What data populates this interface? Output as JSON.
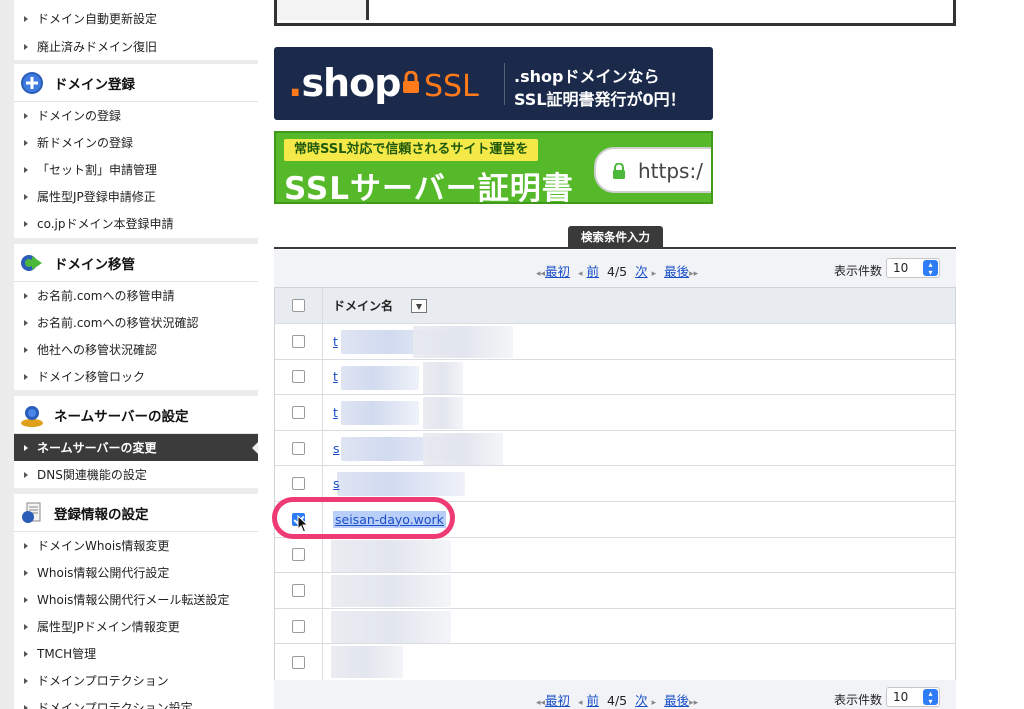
{
  "sidebar": {
    "top_items": [
      {
        "label": "ドメイン自動更新設定"
      },
      {
        "label": "廃止済みドメイン復旧"
      }
    ],
    "sections": [
      {
        "title": "ドメイン登録",
        "icon": "plus-circle-icon",
        "items": [
          {
            "label": "ドメインの登録"
          },
          {
            "label": "新ドメインの登録"
          },
          {
            "label": "「セット割」申請管理"
          },
          {
            "label": "属性型JP登録申請修正"
          },
          {
            "label": "co.jpドメイン本登録申請"
          }
        ]
      },
      {
        "title": "ドメイン移管",
        "icon": "transfer-icon",
        "items": [
          {
            "label": "お名前.comへの移管申請"
          },
          {
            "label": "お名前.comへの移管状況確認"
          },
          {
            "label": "他社への移管状況確認"
          },
          {
            "label": "ドメイン移管ロック"
          }
        ]
      },
      {
        "title": "ネームサーバーの設定",
        "icon": "users-icon",
        "items": [
          {
            "label": "ネームサーバーの変更",
            "active": true
          },
          {
            "label": "DNS関連機能の設定"
          }
        ]
      },
      {
        "title": "登録情報の設定",
        "icon": "document-icon",
        "items": [
          {
            "label": "ドメインWhois情報変更"
          },
          {
            "label": "Whois情報公開代行設定"
          },
          {
            "label": "Whois情報公開代行メール転送設定"
          },
          {
            "label": "属性型JPドメイン情報変更"
          },
          {
            "label": "TMCH管理"
          },
          {
            "label": "ドメインプロテクション"
          },
          {
            "label": "ドメインプロテクション設定"
          }
        ]
      }
    ]
  },
  "banners": {
    "shop": {
      "logo_dot": ".",
      "logo_text": "shop",
      "ssl_text": "SSL",
      "line1": ".shopドメインなら",
      "line2": "SSL証明書発行が0円！"
    },
    "ssl": {
      "pill": "常時SSL対応で信頼されるサイト運営を",
      "big": "SSLサーバー証明書",
      "url": "https:/"
    }
  },
  "search_tab": "検索条件入力",
  "pager": {
    "first": "最初",
    "prev": "前",
    "page": "4/5",
    "next": "次",
    "last": "最後",
    "count_label": "表示件数",
    "count_value": "10",
    "left_arrows": "◂◂",
    "right_arrows": "▸▸",
    "left_arrow": "◂",
    "right_arrow": "▸"
  },
  "table": {
    "header": "ドメイン名",
    "rows": [
      {
        "domain": "t",
        "checked": false
      },
      {
        "domain": "t",
        "checked": false
      },
      {
        "domain": "t",
        "checked": false
      },
      {
        "domain": "s",
        "checked": false
      },
      {
        "domain": "s",
        "checked": false
      },
      {
        "domain": "seisan-dayo.work",
        "checked": true
      },
      {
        "domain": "",
        "checked": false
      },
      {
        "domain": "",
        "checked": false
      },
      {
        "domain": "",
        "checked": false
      },
      {
        "domain": "",
        "checked": false
      }
    ]
  },
  "colors": {
    "link": "#1a4fc8",
    "highlight": "#ee3b74",
    "checkbox": "#2f7df6",
    "sidebar_active": "#3b3b3b"
  }
}
